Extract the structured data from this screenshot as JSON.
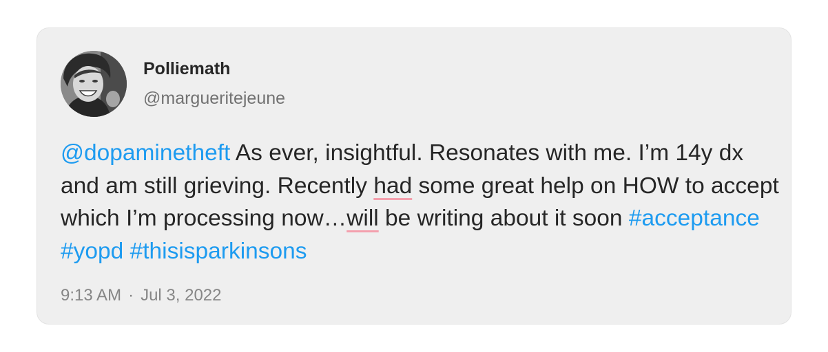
{
  "tweet": {
    "author": {
      "display_name": "Polliemath",
      "handle": "@margueritejeune",
      "avatar_icon": "profile-photo"
    },
    "segments": [
      {
        "text": "@dopaminetheft",
        "type": "mention"
      },
      {
        "text": " As ever, insightful. Resonates with me. I’m 14y dx and am still grieving. Recently ",
        "type": "text"
      },
      {
        "text": "had",
        "type": "spellcheck"
      },
      {
        "text": " some great help on HOW to accept which I’m processing now…",
        "type": "text"
      },
      {
        "text": "will",
        "type": "spellcheck"
      },
      {
        "text": " be writing about it soon ",
        "type": "text"
      },
      {
        "text": "#acceptance",
        "type": "hashtag"
      },
      {
        "text": " ",
        "type": "text"
      },
      {
        "text": "#yopd",
        "type": "hashtag"
      },
      {
        "text": " ",
        "type": "text"
      },
      {
        "text": "#thisisparkinsons",
        "type": "hashtag"
      }
    ],
    "time": "9:13 AM",
    "separator": "·",
    "date": "Jul 3, 2022"
  },
  "colors": {
    "card_background": "#efefef",
    "link": "#1d9bf0",
    "text": "#262626",
    "muted": "#868686",
    "spellcheck_underline": "#f4a0ad"
  }
}
